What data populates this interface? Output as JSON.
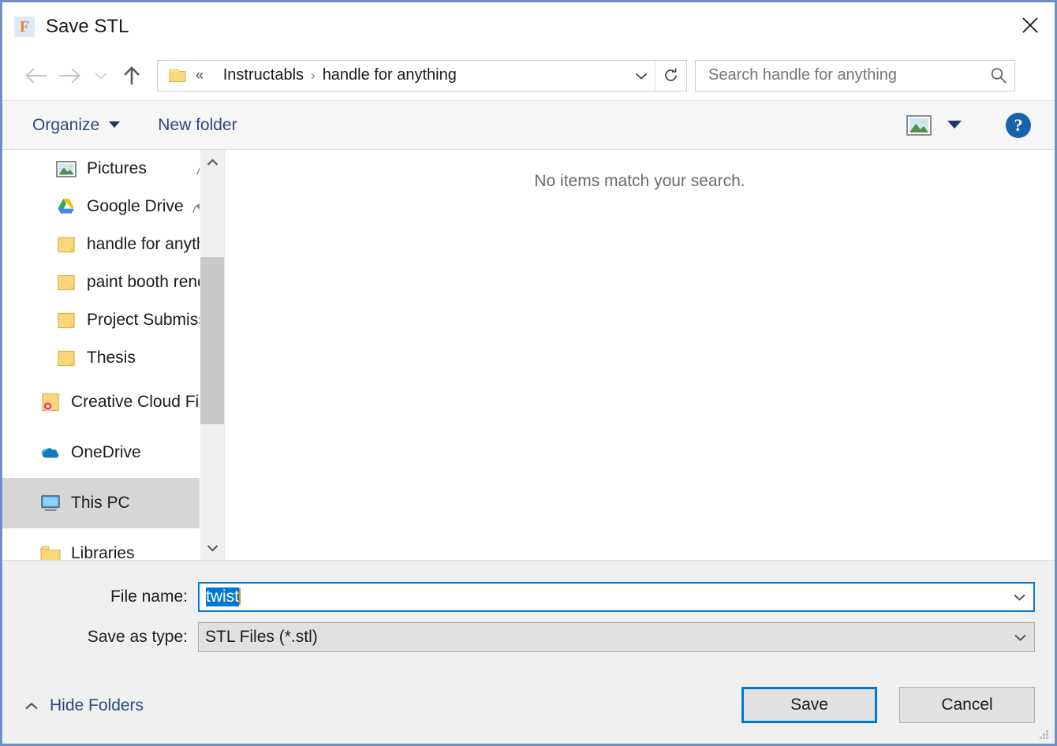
{
  "window": {
    "title": "Save STL",
    "app_icon": "freecad-f-icon",
    "close_label": "✕"
  },
  "nav": {
    "back_icon": "arrow-left-icon",
    "forward_icon": "arrow-right-icon",
    "recent_icon": "chevron-down-icon",
    "up_icon": "arrow-up-icon",
    "refresh_icon": "refresh-icon",
    "address": {
      "folder_icon": "folder-icon",
      "overflow": "«",
      "crumbs": [
        "Instructabls",
        "handle for anything"
      ],
      "separator": "›",
      "dropdown_icon": "chevron-down-icon"
    },
    "search": {
      "placeholder": "Search handle for anything",
      "value": "",
      "icon": "search-icon"
    }
  },
  "toolbar": {
    "organize_label": "Organize",
    "organize_caret_icon": "caret-down-icon",
    "new_folder_label": "New folder",
    "view_icon": "picture-thumbnail-icon",
    "view_caret_icon": "caret-down-icon",
    "help_label": "?",
    "help_icon": "help-circle-icon"
  },
  "sidebar": {
    "items": [
      {
        "label": "Pictures",
        "icon": "picture-thumbnail-icon",
        "pinned": true,
        "indent": true,
        "selected": false
      },
      {
        "label": "Google Drive",
        "icon": "google-drive-icon",
        "pinned": true,
        "indent": true,
        "selected": false
      },
      {
        "label": "handle for anyth",
        "icon": "folder-icon",
        "pinned": false,
        "indent": true,
        "selected": false
      },
      {
        "label": "paint booth rend",
        "icon": "folder-icon",
        "pinned": false,
        "indent": true,
        "selected": false
      },
      {
        "label": "Project Submissi",
        "icon": "folder-icon",
        "pinned": false,
        "indent": true,
        "selected": false
      },
      {
        "label": "Thesis",
        "icon": "folder-icon",
        "pinned": false,
        "indent": true,
        "selected": false
      },
      {
        "label": "Creative Cloud Fil",
        "icon": "creative-cloud-files-icon",
        "pinned": false,
        "indent": false,
        "selected": false
      },
      {
        "label": "OneDrive",
        "icon": "onedrive-icon",
        "pinned": false,
        "indent": false,
        "selected": false
      },
      {
        "label": "This PC",
        "icon": "this-pc-monitor-icon",
        "pinned": false,
        "indent": false,
        "selected": true
      },
      {
        "label": "Libraries",
        "icon": "libraries-folder-icon",
        "pinned": false,
        "indent": false,
        "selected": false
      }
    ],
    "scroll_up_icon": "chevron-up-icon",
    "scroll_down_icon": "chevron-down-icon",
    "pin_icon": "pin-icon"
  },
  "filelist": {
    "empty_message": "No items match your search."
  },
  "form": {
    "file_name_label": "File name:",
    "file_name_value": "twist",
    "file_name_selected": true,
    "save_as_type_label": "Save as type:",
    "save_as_type_value": "STL Files (*.stl)",
    "dropdown_icon": "chevron-down-icon"
  },
  "footer": {
    "hide_folders_label": "Hide Folders",
    "hide_folders_icon": "chevron-up-icon",
    "save_label": "Save",
    "cancel_label": "Cancel",
    "resize_grip_icon": "resize-grip-icon"
  },
  "colors": {
    "window_border": "#6f8fbe",
    "accent_blue": "#0078d7",
    "toolbar_link": "#2b4a7a",
    "selection_blue": "#0078d7",
    "caret_orange": "#e8820c",
    "panel_gray": "#f0f0f0",
    "selected_row": "#d6d6d6",
    "help_blue": "#1862b0"
  }
}
